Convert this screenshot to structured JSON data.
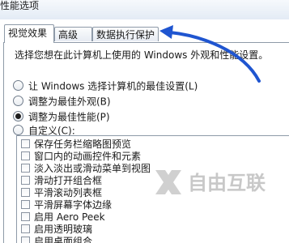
{
  "window": {
    "title": "性能选项"
  },
  "tabs": [
    {
      "label": "视觉效果",
      "active": true
    },
    {
      "label": "高级",
      "active": false
    },
    {
      "label": "数据执行保护",
      "active": false
    }
  ],
  "visual_effects": {
    "description": "选择您想在此计算机上使用的 Windows 外观和性能设置。",
    "options": [
      {
        "label": "让 Windows 选择计算机的最佳设置(L)",
        "checked": false
      },
      {
        "label": "调整为最佳外观(B)",
        "checked": false
      },
      {
        "label": "调整为最佳性能(P)",
        "checked": true
      },
      {
        "label": "自定义(C):",
        "checked": false
      }
    ],
    "effects": [
      "保存任务栏缩略图预览",
      "窗口内的动画控件和元素",
      "淡入淡出或滑动菜单到视图",
      "滑动打开组合框",
      "平滑滚动列表框",
      "平滑屏幕字体边缘",
      "启用 Aero Peek",
      "启用透明玻璃",
      "启用桌面组合"
    ]
  },
  "annotation": {
    "color": "#1f55d0"
  },
  "watermark": {
    "text": "自由互联",
    "color": "#c8c8c8"
  }
}
